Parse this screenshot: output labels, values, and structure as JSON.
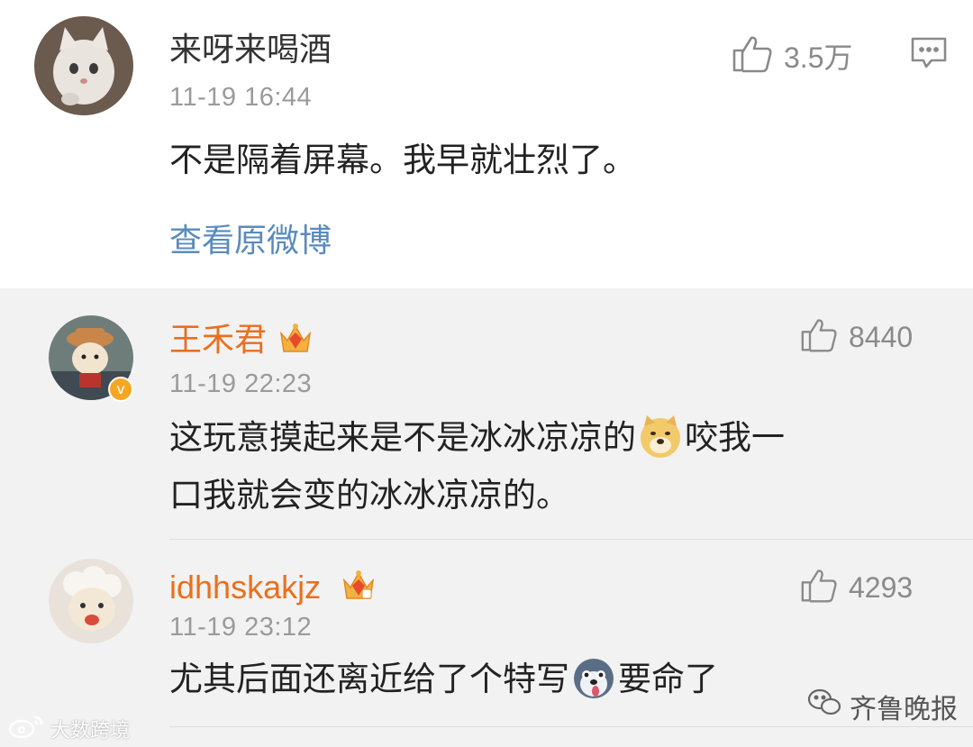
{
  "main_comment": {
    "username": "来呀来喝酒",
    "timestamp": "11-19 16:44",
    "text": "不是隔着屏幕。我早就壮烈了。",
    "likes": "3.5万",
    "view_original": "查看原微博"
  },
  "replies": [
    {
      "username": "王禾君",
      "timestamp": "11-19 22:23",
      "text_line1_a": "这玩意摸起来是不是冰冰凉凉的",
      "text_line1_b": "咬我一",
      "text_line2": "口我就会变的冰冰凉凉的。",
      "likes": "8440",
      "emoji": "doge-emoji"
    },
    {
      "username": "idhhskakjz",
      "timestamp": "11-19 23:12",
      "text_a": "尤其后面还离近给了个特写",
      "text_b": "要命了",
      "likes": "4293",
      "emoji": "husky-emoji"
    }
  ],
  "watermarks": {
    "left": "大数跨境",
    "right": "齐鲁晚报"
  },
  "colors": {
    "vip_name": "#e8701e",
    "link": "#5a8bbd",
    "reply_bg": "#f2f2f2"
  }
}
